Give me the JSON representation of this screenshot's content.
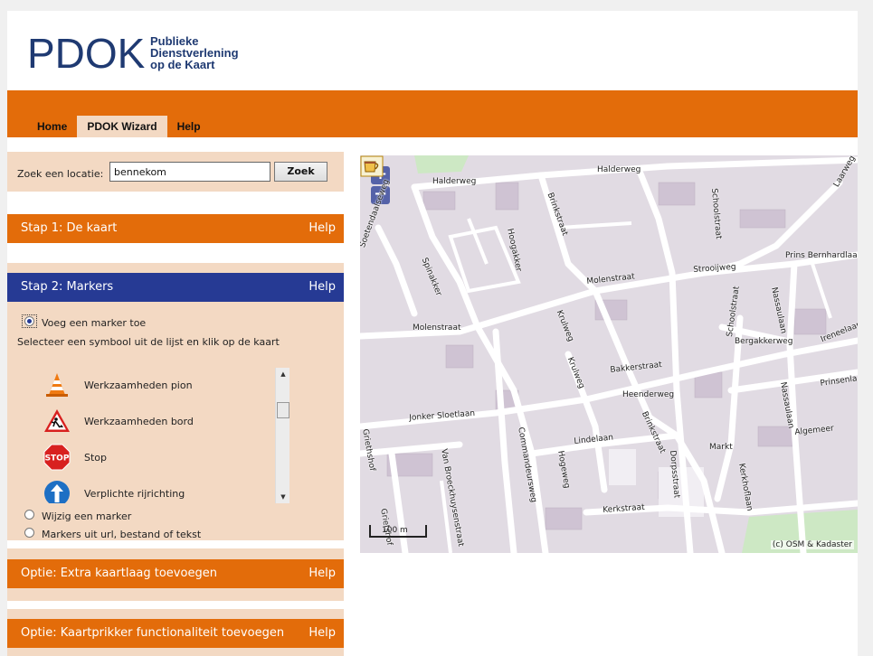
{
  "header": {
    "logo_text": "PDOK",
    "logo_sub": [
      "Publieke",
      "Dienstverlening",
      "op de Kaart"
    ]
  },
  "nav": {
    "items": [
      {
        "label": "Home",
        "active": false
      },
      {
        "label": "PDOK Wizard",
        "active": true
      },
      {
        "label": "Help",
        "active": false
      }
    ]
  },
  "search": {
    "label": "Zoek een locatie:",
    "value": "bennekom",
    "button_label": "Zoek"
  },
  "panels": {
    "stap1": {
      "title": "Stap 1: De kaart",
      "help": "Help"
    },
    "stap2": {
      "title": "Stap 2: Markers",
      "help": "Help"
    },
    "extra": {
      "title": "Optie: Extra kaartlaag toevoegen",
      "help": "Help"
    },
    "kaartprikker": {
      "title": "Optie: Kaartprikker functionaliteit toevoegen",
      "help": "Help"
    }
  },
  "markers": {
    "add_option": "Voeg een marker toe",
    "instruction": "Selecteer een symbool uit de lijst en klik op de kaart",
    "symbols": [
      {
        "label": "Werkzaamheden pion",
        "icon": "traffic-cone-icon"
      },
      {
        "label": "Werkzaamheden bord",
        "icon": "roadwork-sign-icon"
      },
      {
        "label": "Stop",
        "icon": "stop-sign-icon"
      },
      {
        "label": "Verplichte rijrichting",
        "icon": "mandatory-direction-icon"
      }
    ],
    "edit_option": "Wijzig een marker",
    "import_option": "Markers uit url, bestand of tekst"
  },
  "map": {
    "zoom_in": "+",
    "zoom_out": "−",
    "scale": "100 m",
    "attribution": "(c) OSM & Kadaster",
    "streets": [
      "Halderweg",
      "Halderweg",
      "Soetendaalseweg",
      "Spinakker",
      "Hoogakker",
      "Brinkstraat",
      "Schoolstraat",
      "Laarweg",
      "Prins Bernhardlaan",
      "Molenstraat",
      "Strooijweg",
      "Molenstraat",
      "Krulweg",
      "Krulweg",
      "Schoolstraat",
      "Nassaulaan",
      "Bergakkerweg",
      "Ireneelaan",
      "Bakkerstraat",
      "Prinsenlaan",
      "Jonker Sloetlaan",
      "Heenderweg",
      "Brinkstraat",
      "Nassaulaan",
      "Algemeer",
      "Griethshof",
      "Van Broeckhuysenstraat",
      "Commandeursweg",
      "Lindelaan",
      "Hogeweg",
      "Dorpsstraat",
      "Markt",
      "Kerkhoflaan",
      "Kerkstraat",
      "Grietshof"
    ]
  }
}
